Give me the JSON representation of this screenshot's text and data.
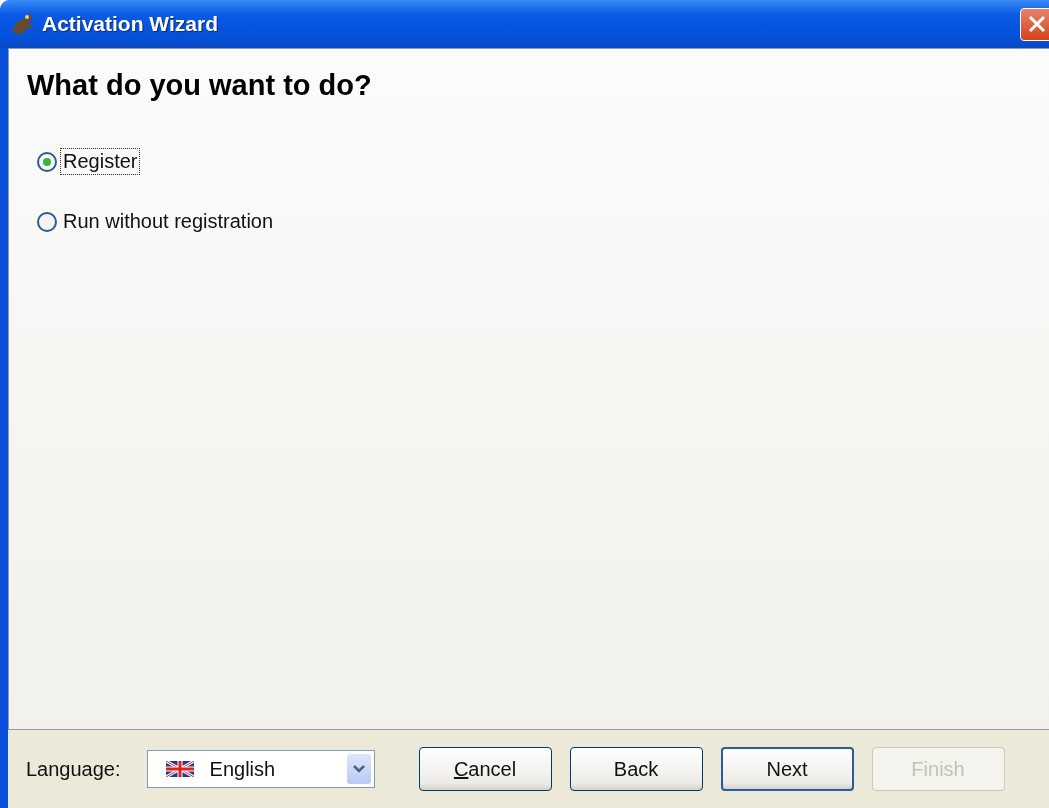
{
  "window": {
    "title": "Activation Wizard"
  },
  "heading": "What do you want to do?",
  "options": [
    {
      "label": "Register",
      "selected": true,
      "focused": true
    },
    {
      "label": "Run without registration",
      "selected": false,
      "focused": false
    }
  ],
  "footer": {
    "language_label": "Language:",
    "language": {
      "value": "English"
    },
    "buttons": [
      {
        "label": "Cancel",
        "underline_first": true,
        "disabled": false,
        "default": false
      },
      {
        "label": "Back",
        "underline_first": false,
        "disabled": false,
        "default": false
      },
      {
        "label": "Next",
        "underline_first": false,
        "disabled": false,
        "default": true
      },
      {
        "label": "Finish",
        "underline_first": false,
        "disabled": true,
        "default": false
      }
    ]
  }
}
